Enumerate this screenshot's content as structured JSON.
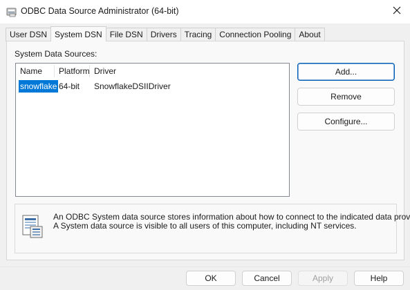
{
  "window": {
    "title": "ODBC Data Source Administrator (64-bit)",
    "close_icon": "close-icon",
    "app_icon": "odbc-admin-icon"
  },
  "tabs": [
    {
      "label": "User DSN",
      "active": false
    },
    {
      "label": "System DSN",
      "active": true
    },
    {
      "label": "File DSN",
      "active": false
    },
    {
      "label": "Drivers",
      "active": false
    },
    {
      "label": "Tracing",
      "active": false
    },
    {
      "label": "Connection Pooling",
      "active": false
    },
    {
      "label": "About",
      "active": false
    }
  ],
  "system_dsn": {
    "section_label": "System Data Sources:",
    "columns": [
      "Name",
      "Platform",
      "Driver"
    ],
    "rows": [
      {
        "name": "snowflake",
        "platform": "64-bit",
        "driver": "SnowflakeDSIIDriver",
        "selected": true
      }
    ],
    "buttons": {
      "add": "Add...",
      "remove": "Remove",
      "configure": "Configure..."
    },
    "info": {
      "icon": "data-source-info-icon",
      "line1": "An ODBC System data source stores information about how to connect to the indicated data provider.",
      "line2": "A System data source is visible to all users of this computer, including NT services."
    }
  },
  "footer": {
    "ok": "OK",
    "cancel": "Cancel",
    "apply": "Apply",
    "help": "Help"
  },
  "colors": {
    "selection": "#0078d7",
    "accent_border": "#005fb8",
    "dialog_bg": "#f0f0f0"
  }
}
